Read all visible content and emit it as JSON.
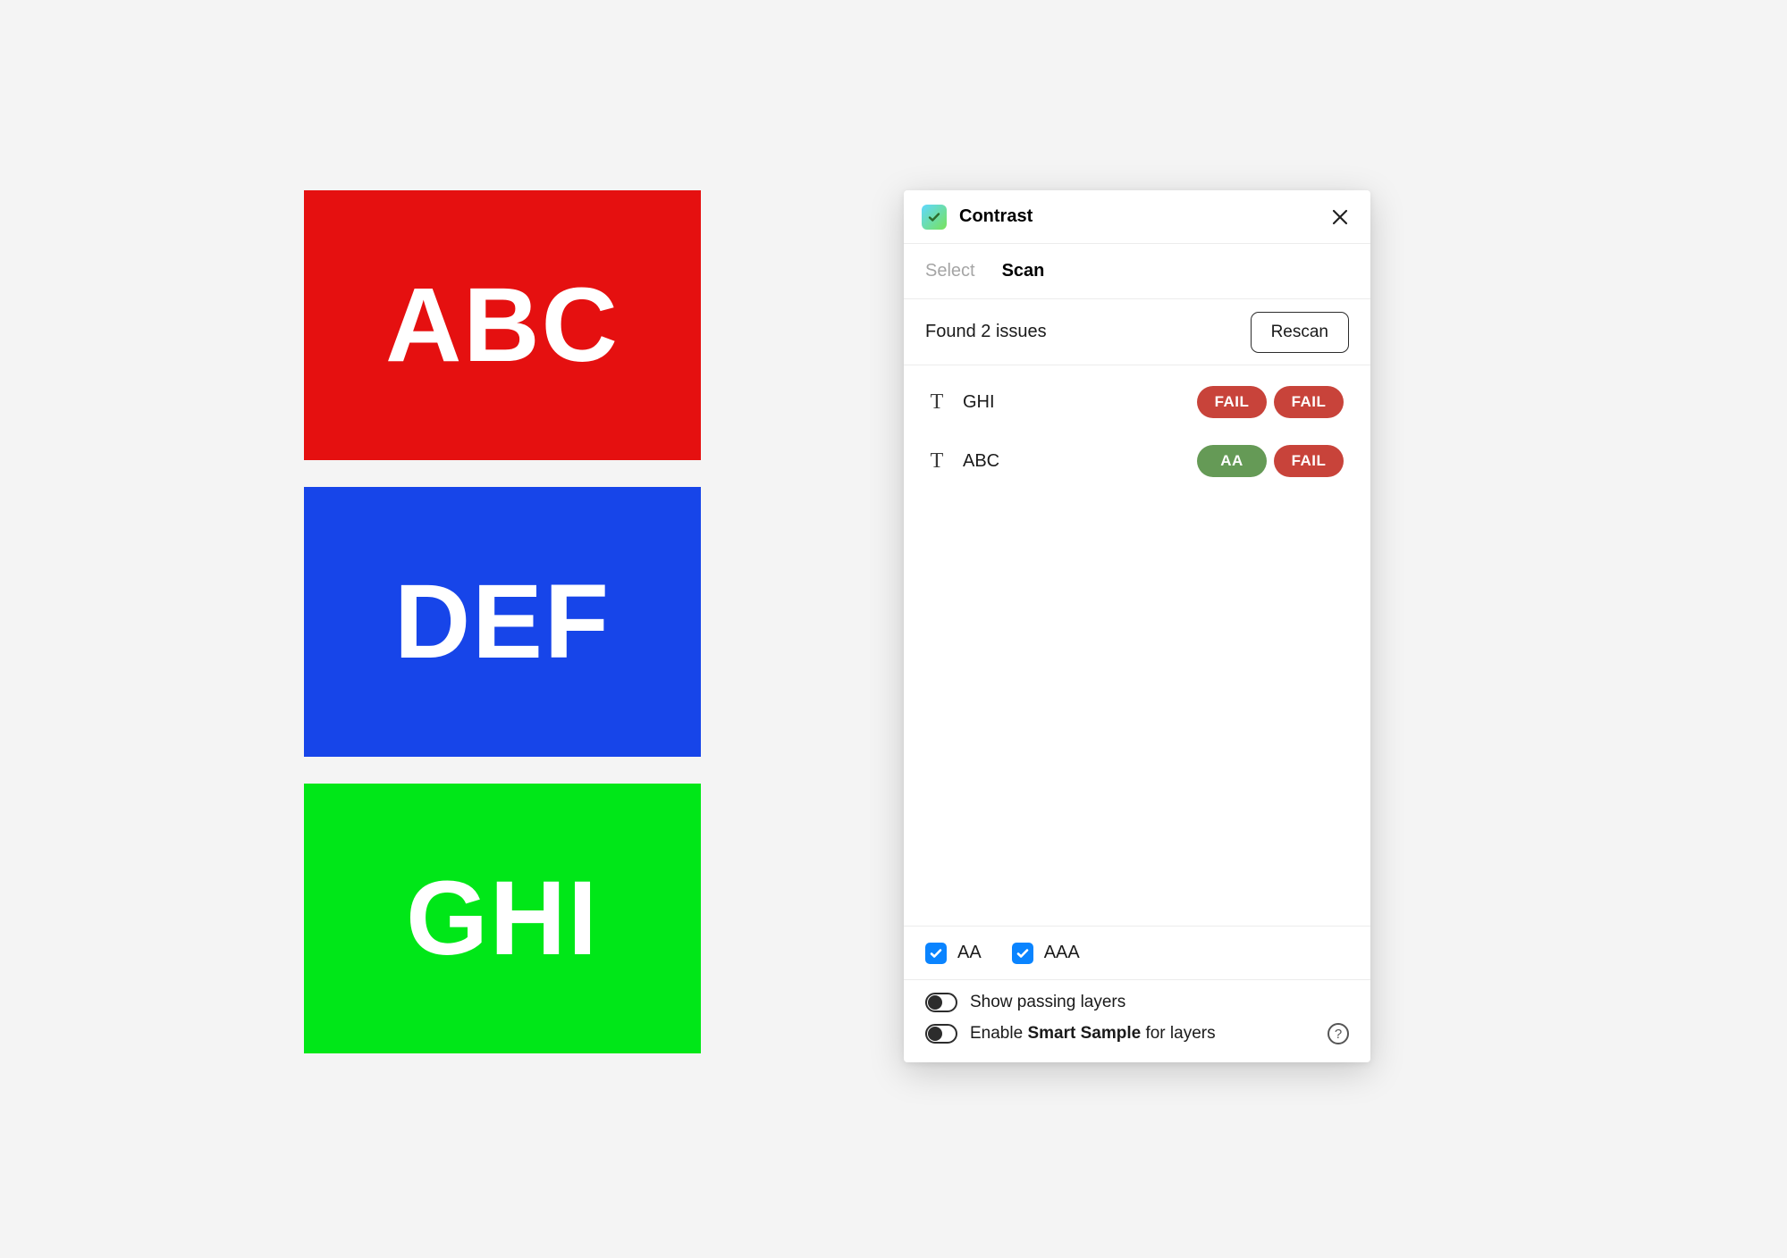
{
  "canvas": {
    "swatches": [
      {
        "text": "ABC",
        "bg": "#e51010"
      },
      {
        "text": "DEF",
        "bg": "#1745e9"
      },
      {
        "text": "GHI",
        "bg": "#00e718"
      }
    ]
  },
  "panel": {
    "title": "Contrast",
    "tabs": [
      {
        "label": "Select",
        "active": false
      },
      {
        "label": "Scan",
        "active": true
      }
    ],
    "summary_text": "Found 2 issues",
    "rescan_label": "Rescan",
    "results": [
      {
        "label": "GHI",
        "badges": [
          {
            "text": "FAIL",
            "kind": "fail"
          },
          {
            "text": "FAIL",
            "kind": "fail"
          }
        ]
      },
      {
        "label": "ABC",
        "badges": [
          {
            "text": "AA",
            "kind": "pass"
          },
          {
            "text": "FAIL",
            "kind": "fail"
          }
        ]
      }
    ],
    "filters": [
      {
        "label": "AA",
        "checked": true
      },
      {
        "label": "AAA",
        "checked": true
      }
    ],
    "options": {
      "show_passing_label": "Show passing layers",
      "smart_sample_prefix": "Enable ",
      "smart_sample_bold": "Smart Sample",
      "smart_sample_suffix": " for layers"
    }
  }
}
